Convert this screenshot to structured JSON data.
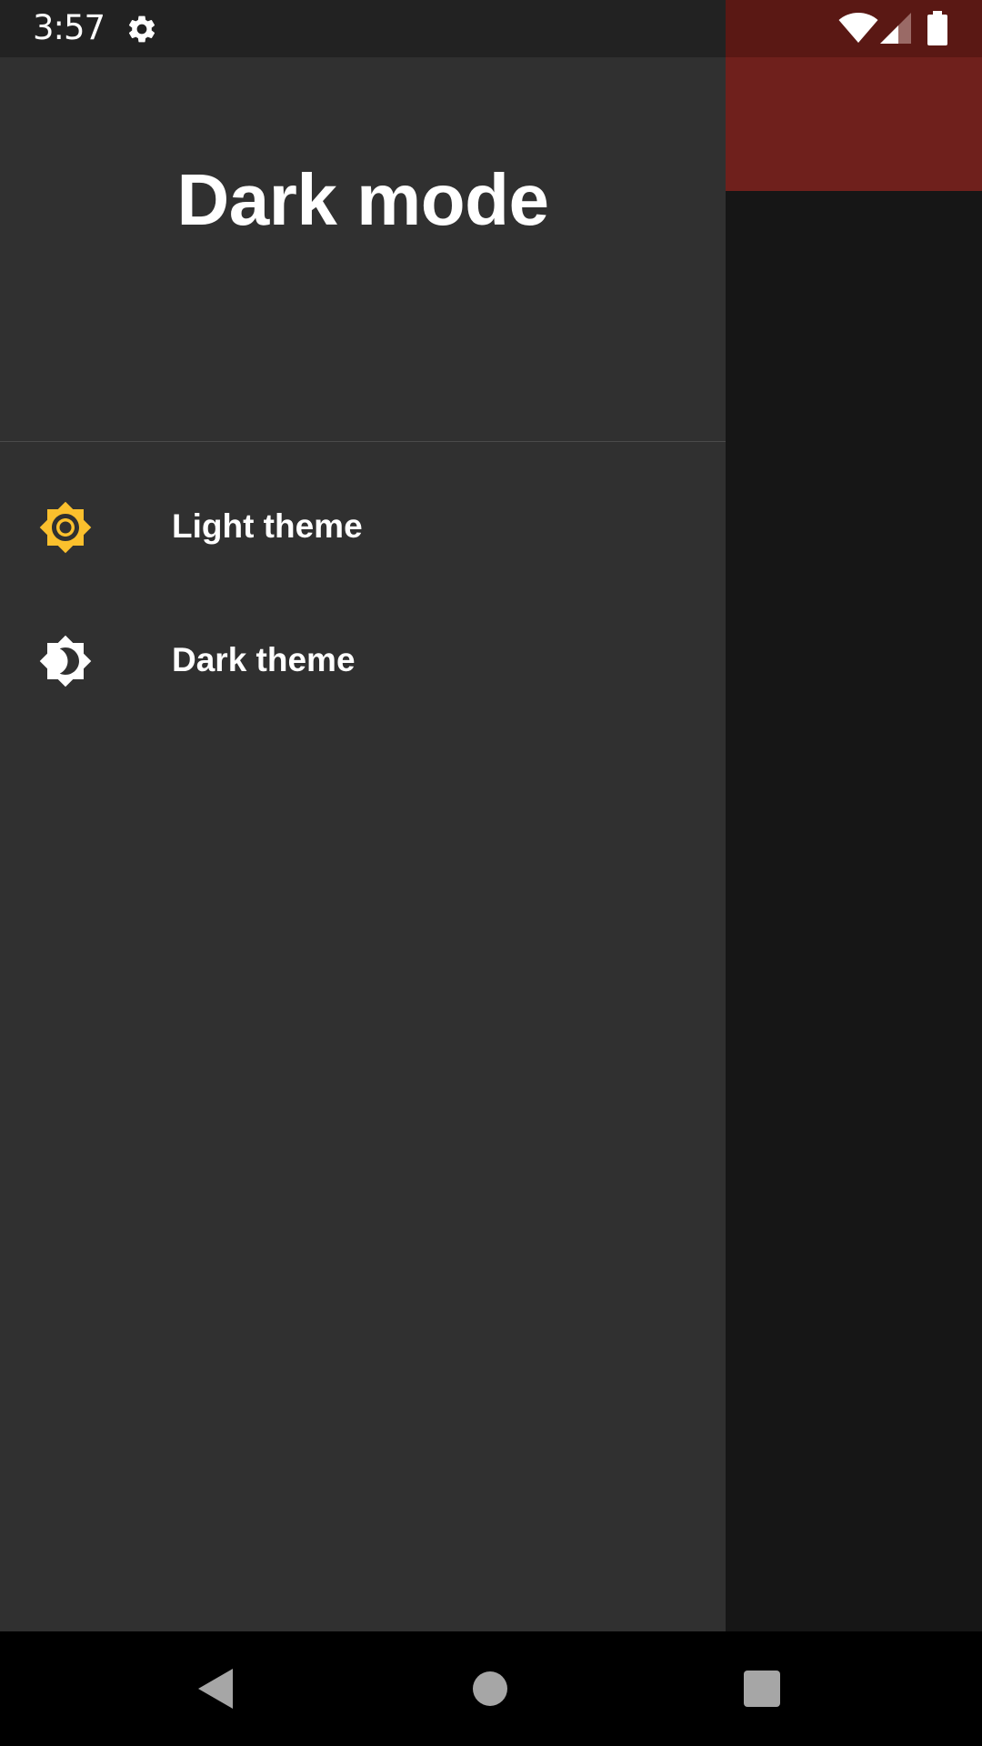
{
  "status_bar": {
    "time": "3:57",
    "icons": [
      "gear-icon",
      "wifi-icon",
      "signal-icon",
      "battery-icon"
    ]
  },
  "drawer": {
    "title": "Dark mode",
    "items": [
      {
        "label": "Light theme",
        "icon": "light-theme-icon",
        "icon_color": "#FBC02D"
      },
      {
        "label": "Dark theme",
        "icon": "dark-theme-icon",
        "icon_color": "#FFFFFF"
      }
    ]
  },
  "app": {
    "toolbar_color": "#6F201C"
  },
  "nav_bar": {
    "buttons": [
      "back-button",
      "home-button",
      "recents-button"
    ]
  }
}
